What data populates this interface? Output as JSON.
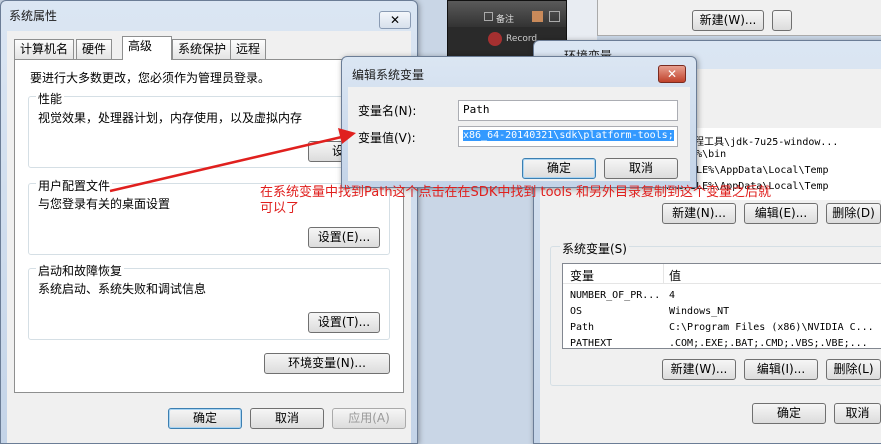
{
  "sys_props": {
    "title": "系统属性",
    "close_glyph": "✕",
    "tabs": [
      "计算机名",
      "硬件",
      "高级",
      "系统保护",
      "远程"
    ],
    "admin_note": "要进行大多数更改，您必须作为管理员登录。",
    "performance": {
      "label": "性能",
      "desc": "视觉效果，处理器计划，内存使用，以及虚拟内存",
      "button": "设置"
    },
    "profiles": {
      "label": "用户配置文件",
      "desc": "与您登录有关的桌面设置",
      "button": "设置(E)..."
    },
    "startup": {
      "label": "启动和故障恢复",
      "desc": "系统启动、系统失败和调试信息",
      "button": "设置(T)..."
    },
    "env_button": "环境变量(N)...",
    "ok": "确定",
    "cancel": "取消",
    "apply": "应用(A)"
  },
  "edit_var": {
    "title": "编辑系统变量",
    "close_glyph": "✕",
    "name_label": "变量名(N):",
    "name_value": "Path",
    "value_label": "变量值(V):",
    "value_value": "x86_64-20140321\\sdk\\platform-tools;",
    "ok": "确定",
    "cancel": "取消"
  },
  "env_vars": {
    "title_fragment": "环境变量",
    "top_new_button": "新建(W)...",
    "user_rows": [
      "VA\\编程工具\\jdk-7u25-window...",
      "_HOME%\\bin",
      "PROFILE%\\AppData\\Local\\Temp",
      "PROFILE%\\AppData\\Local\\Temp"
    ],
    "user_buttons": [
      "新建(N)...",
      "编辑(E)...",
      "删除(D)"
    ],
    "system_label": "系统变量(S)",
    "col_var": "变量",
    "col_val": "值",
    "system_rows": [
      {
        "name": "NUMBER_OF_PR...",
        "value": "4"
      },
      {
        "name": "OS",
        "value": "Windows_NT"
      },
      {
        "name": "Path",
        "value": "C:\\Program Files (x86)\\NVIDIA C..."
      },
      {
        "name": "PATHEXT",
        "value": ".COM;.EXE;.BAT;.CMD;.VBS;.VBE;..."
      }
    ],
    "system_buttons": [
      "新建(W)...",
      "编辑(I)...",
      "删除(L)"
    ],
    "ok": "确定",
    "cancel": "取消"
  },
  "media_bar": {
    "label1": "备注",
    "label2": "Record"
  },
  "annotation": {
    "line1": "在系统变量中找到Path这个点击在在SDK中找到 tools 和另外目录复制到这个变量之后就",
    "line2": "可以了"
  }
}
